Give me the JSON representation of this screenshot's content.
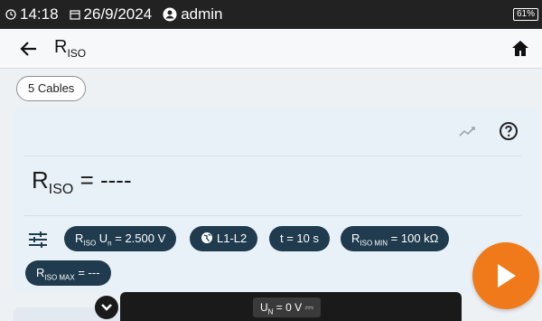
{
  "status_bar": {
    "time": "14:18",
    "date": "26/9/2024",
    "user": "admin",
    "battery": "61%"
  },
  "header": {
    "title_main": "R",
    "title_sub": "ISO"
  },
  "cables_chip": "5 Cables",
  "measurement": {
    "symbol": "R",
    "symbol_sub": "ISO",
    "value_text": " = ----"
  },
  "parameters": {
    "un": {
      "r": "R",
      "r_sub": "ISO",
      "u": " U",
      "u_sub": "n",
      "value": " = 2.500 V"
    },
    "circuit": {
      "label": "L1-L2"
    },
    "time": {
      "label": "t = 10 s"
    },
    "riso_min": {
      "r": "R",
      "r_sub": "ISO MIN",
      "value": " = 100 kΩ"
    },
    "riso_max": {
      "r": "R",
      "r_sub": "ISO MAX",
      "value": " = ---"
    }
  },
  "bottom_bar": {
    "voltage_u": "U",
    "voltage_sub": "N",
    "voltage_value": " = 0 V ⎓"
  },
  "colors": {
    "status_bg": "#222222",
    "card_bg": "#e9f1f8",
    "chip_bg": "#1f3b4d",
    "accent": "#f07a1a"
  },
  "icons": [
    "clock-icon",
    "calendar-icon",
    "user-icon",
    "back-arrow-icon",
    "home-icon",
    "trend-icon",
    "help-icon",
    "settings-sliders-icon",
    "globe-icon",
    "chevron-down-icon",
    "play-icon"
  ]
}
